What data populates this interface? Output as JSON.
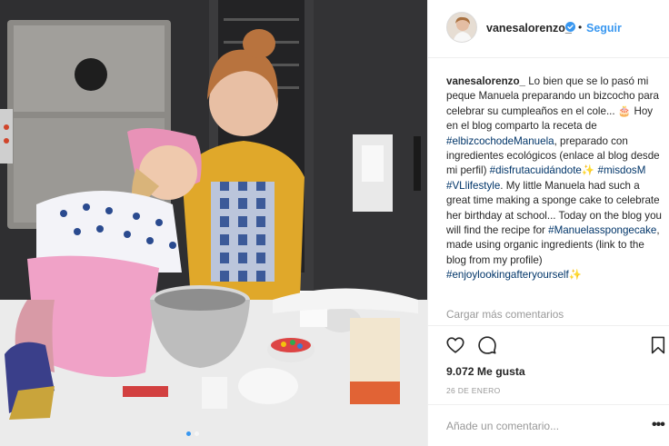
{
  "header": {
    "username": "vanesalorenzo_",
    "separator": "•",
    "follow_label": "Seguir"
  },
  "caption": {
    "author": "vanesalorenzo_",
    "part1": " Lo bien que se lo pasó mi peque Manuela preparando un bizcocho para celebrar su cumpleaños en el cole... ",
    "emoji_cake": "🎂",
    "part2": " Hoy en el blog comparto la receta de ",
    "tag1": "#elbizcochodeManuela",
    "part3": ", preparado con ingredientes ecológicos (enlace al blog desde mi perfil) ",
    "tag2": "#disfrutacuidándote",
    "emoji_sparkle1": "✨",
    "part4": " ",
    "tag3": "#misdosM",
    "part5": " ",
    "tag4": "#VLlifestyle",
    "part6": ". My little Manuela had such a great time making a sponge cake to celebrate her birthday at school... Today on the blog you will find the recipe for ",
    "tag5": "#Manuelasspongecake",
    "part7": ", made using organic ingredients (link to the blog from my profile) ",
    "tag6": "#enjoylookingafteryourself",
    "emoji_sparkle2": "✨"
  },
  "load_more_label": "Cargar más comentarios",
  "likes_label": "9.072 Me gusta",
  "date_label": "26 DE ENERO",
  "comment": {
    "placeholder": "Añade un comentario...",
    "options_label": "•••"
  },
  "icons": {
    "like": "heart-icon",
    "comment": "comment-icon",
    "save": "bookmark-icon",
    "verified": "verified-badge-icon"
  },
  "colors": {
    "link_blue": "#3897f0",
    "hashtag": "#003569",
    "muted": "#999999",
    "text": "#262626"
  },
  "carousel": {
    "total": 2,
    "active": 1
  }
}
